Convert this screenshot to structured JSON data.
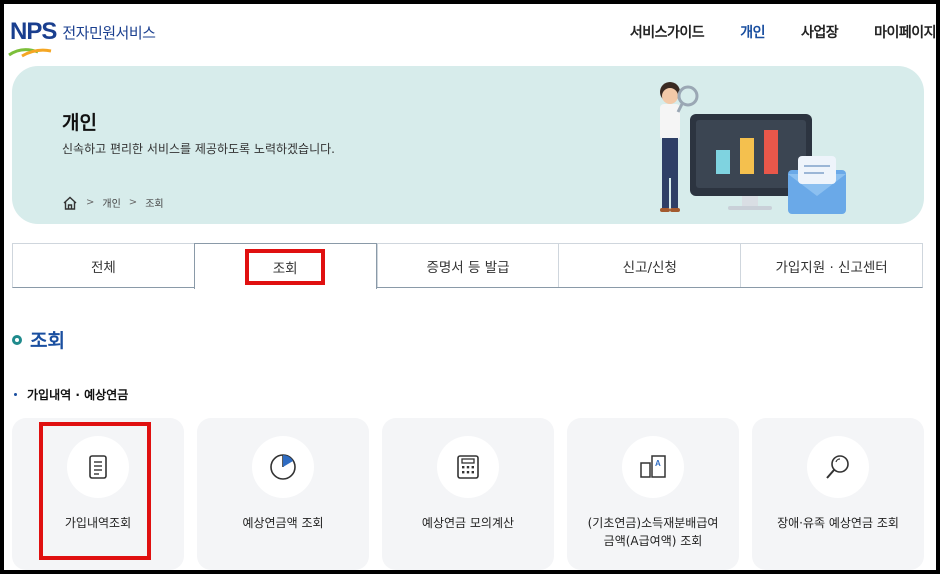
{
  "header": {
    "logo_mark": "NPS",
    "logo_text": "전자민원서비스",
    "nav": [
      {
        "label": "서비스가이드",
        "active": false
      },
      {
        "label": "개인",
        "active": true
      },
      {
        "label": "사업장",
        "active": false
      },
      {
        "label": "마이페이지",
        "active": false
      }
    ]
  },
  "banner": {
    "title": "개인",
    "description": "신속하고 편리한 서비스를 제공하도록 노력하겠습니다.",
    "breadcrumb": [
      "개인",
      "조회"
    ]
  },
  "tabs": [
    {
      "label": "전체",
      "active": false
    },
    {
      "label": "조회",
      "active": true,
      "highlighted": true
    },
    {
      "label": "증명서 등 발급",
      "active": false
    },
    {
      "label": "신고/신청",
      "active": false
    },
    {
      "label": "가입지원 · 신고센터",
      "active": false
    }
  ],
  "section": {
    "title": "조회",
    "subtitle": "가입내역 · 예상연금"
  },
  "cards": [
    {
      "label": "가입내역조회",
      "icon": "document-icon",
      "highlighted": true
    },
    {
      "label": "예상연금액 조회",
      "icon": "pie-chart-icon",
      "highlighted": false
    },
    {
      "label": "예상연금 모의계산",
      "icon": "calculator-icon",
      "highlighted": false
    },
    {
      "label_line1": "(기초연금)소득재분배급여",
      "label_line2": "금액(A급여액) 조회",
      "icon": "doc-a-icon",
      "highlighted": false
    },
    {
      "label": "장애·유족 예상연금 조회",
      "icon": "magnifier-icon",
      "highlighted": false
    }
  ],
  "colors": {
    "brand_blue": "#1a4fa0",
    "banner_bg": "#d7eceb",
    "highlight_red": "#e01010",
    "teal": "#1f8a8c"
  }
}
